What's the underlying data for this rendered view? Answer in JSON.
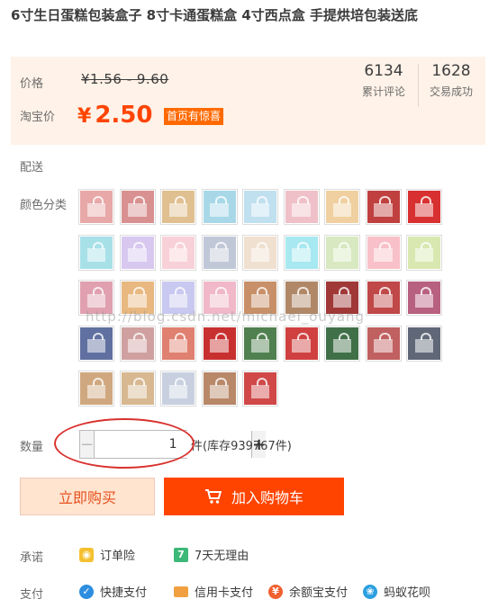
{
  "title": "6寸生日蛋糕包装盒子 8寸卡通蛋糕盒 4寸西点盒 手提烘培包装送底",
  "price": {
    "label": "价格",
    "original": "¥1.56 - 9.60",
    "promo_label": "淘宝价",
    "currency": "¥",
    "current": "2.50",
    "promo_badge": "首页有惊喜"
  },
  "stats": [
    {
      "value": "6134",
      "label": "累计评论"
    },
    {
      "value": "1628",
      "label": "交易成功"
    }
  ],
  "delivery_label": "配送",
  "color_label": "颜色分类",
  "swatch_colors": [
    "#e8a8a8",
    "#d89090",
    "#e0c090",
    "#a8d8e8",
    "#c0e0f0",
    "#f0c0c8",
    "#f0d0a0",
    "#c04040",
    "#d83030",
    "#a8e0e8",
    "#d8c8f0",
    "#f8d0d8",
    "#c0c8d8",
    "#f0e0d0",
    "#a8e8f0",
    "#d8e8c0",
    "#f8c0c8",
    "#d8e8b0",
    "#e0a0b0",
    "#e8b880",
    "#c8c8f0",
    "#f0b8c8",
    "#c89068",
    "#b08868",
    "#a03838",
    "#c04848",
    "#b86080",
    "#6070a0",
    "#d0a0a0",
    "#e08070",
    "#c83030",
    "#508050",
    "#d04040",
    "#407048",
    "#c06060",
    "#606878",
    "#d0a880",
    "#d8b890",
    "#c8d0e0",
    "#b88868",
    "#d04848"
  ],
  "watermark": "http://blog.csdn.net/michael_ouyang",
  "quantity": {
    "label": "数量",
    "value": "1",
    "minus": "−",
    "plus": "+",
    "unit": "件",
    "stock": "(库存939767件)"
  },
  "buttons": {
    "buy_now": "立即购买",
    "add_cart": "加入购物车"
  },
  "promise": {
    "label": "承诺",
    "items": [
      {
        "icon": "shield-icon",
        "text": "订单险",
        "color": "#f5c030"
      },
      {
        "icon": "seven-day-icon",
        "text": "7天无理由",
        "color": "#3cb878",
        "glyph": "7"
      }
    ]
  },
  "payment": {
    "label": "支付",
    "items": [
      {
        "icon": "quick-pay-icon",
        "text": "快捷支付",
        "color": "#2d8ee0"
      },
      {
        "icon": "credit-card-icon",
        "text": "信用卡支付",
        "color": "#f0a040"
      },
      {
        "icon": "yuebao-icon",
        "text": "余额宝支付",
        "color": "#f06030"
      },
      {
        "icon": "huabei-icon",
        "text": "蚂蚁花呗",
        "color": "#2da0e0"
      }
    ]
  }
}
